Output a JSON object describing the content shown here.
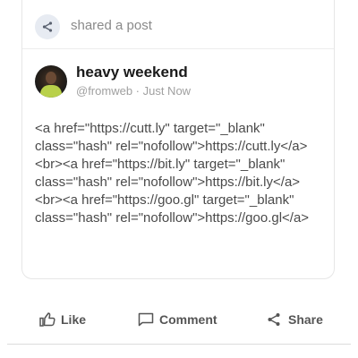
{
  "shared_header": {
    "icon": "share-icon",
    "label": "shared a post"
  },
  "post": {
    "author_name": "heavy weekend",
    "author_meta": "@fromweb · Just Now",
    "body": "<a href=\"https://cutt.ly\" target=\"_blank\" class=\"hash\" rel=\"nofollow\">https://cutt.ly</a> <br><a href=\"https://bit.ly\" target=\"_blank\" class=\"hash\" rel=\"nofollow\">https://bit.ly</a> <br><a href=\"https://goo.gl\" target=\"_blank\" class=\"hash\" rel=\"nofollow\">https://goo.gl</a>"
  },
  "actions": {
    "like_label": "Like",
    "comment_label": "Comment",
    "share_label": "Share",
    "like_icon": "thumbs-up-icon",
    "comment_icon": "comment-icon",
    "share_icon": "share-icon"
  },
  "colors": {
    "text_muted": "#8a8a8a",
    "text_body": "#4a4a4a",
    "text_action": "#555555",
    "icon_bg": "#e7ebf2"
  }
}
